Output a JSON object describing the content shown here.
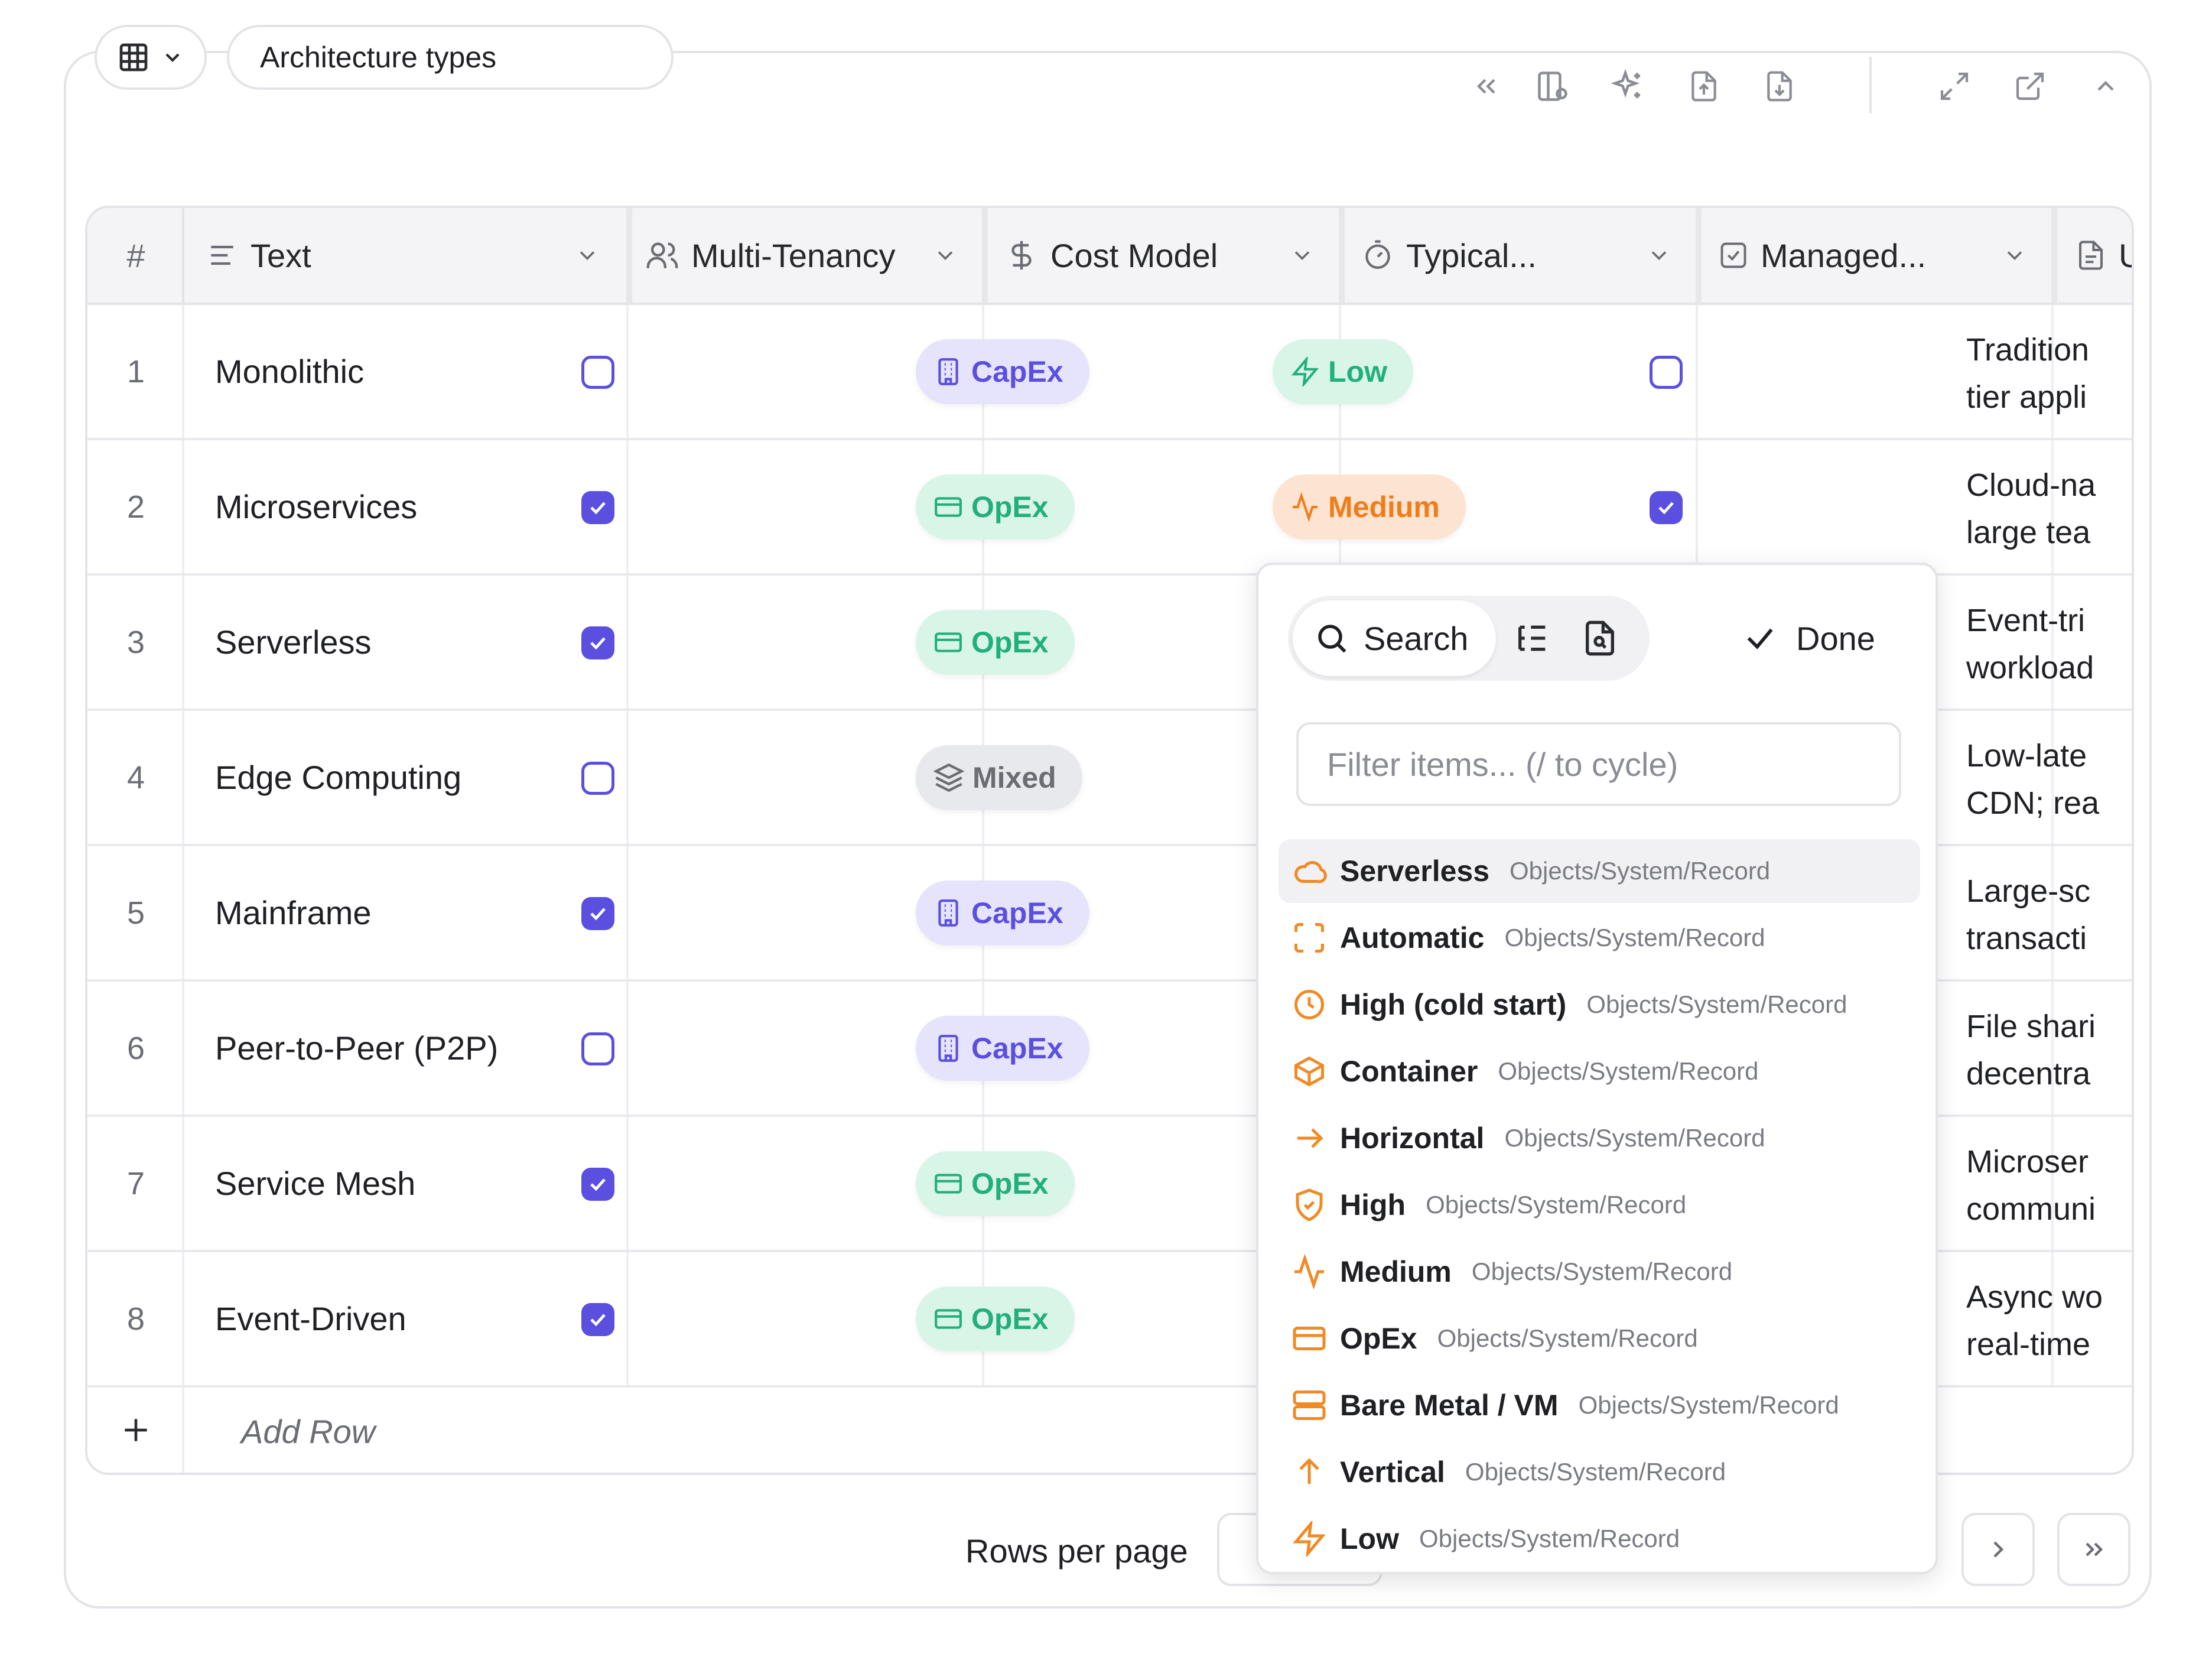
{
  "toolbar": {
    "table_title": "Architecture types"
  },
  "table": {
    "columns": [
      {
        "label": "#"
      },
      {
        "label": "Text",
        "icon": "text-lines-icon"
      },
      {
        "label": "Multi-Tenancy",
        "icon": "users-icon"
      },
      {
        "label": "Cost Model",
        "icon": "dollar-icon"
      },
      {
        "label": "Typical...",
        "icon": "timer-icon"
      },
      {
        "label": "Managed...",
        "icon": "checkbox-icon"
      },
      {
        "label": "Use Ca",
        "icon": "document-icon"
      }
    ],
    "rows": [
      {
        "num": "1",
        "text": "Monolithic",
        "multi_tenancy": false,
        "cost_model": "CapEx",
        "typical": "Low",
        "managed": false,
        "use_case": [
          "Tradition",
          "tier appli"
        ]
      },
      {
        "num": "2",
        "text": "Microservices",
        "multi_tenancy": true,
        "cost_model": "OpEx",
        "typical": "Medium",
        "managed": true,
        "use_case": [
          "Cloud-na",
          "large tea"
        ]
      },
      {
        "num": "3",
        "text": "Serverless",
        "multi_tenancy": true,
        "cost_model": "OpEx",
        "use_case": [
          "Event-tri",
          "workload"
        ]
      },
      {
        "num": "4",
        "text": "Edge Computing",
        "multi_tenancy": false,
        "cost_model": "Mixed",
        "use_case": [
          "Low-late",
          "CDN; rea"
        ]
      },
      {
        "num": "5",
        "text": "Mainframe",
        "multi_tenancy": true,
        "cost_model": "CapEx",
        "use_case": [
          "Large-sc",
          "transacti"
        ]
      },
      {
        "num": "6",
        "text": "Peer-to-Peer (P2P)",
        "multi_tenancy": false,
        "cost_model": "CapEx",
        "use_case": [
          "File shari",
          "decentra"
        ]
      },
      {
        "num": "7",
        "text": "Service Mesh",
        "multi_tenancy": true,
        "cost_model": "OpEx",
        "use_case": [
          "Microser",
          "communi"
        ]
      },
      {
        "num": "8",
        "text": "Event-Driven",
        "multi_tenancy": true,
        "cost_model": "OpEx",
        "use_case": [
          "Async wo",
          "real-time"
        ]
      }
    ],
    "add_row_label": "Add Row"
  },
  "footer": {
    "rows_per_page_label": "Rows per page"
  },
  "dropdown": {
    "search_label": "Search",
    "done_label": "Done",
    "filter_placeholder": "Filter items... (/ to cycle)",
    "items": [
      {
        "name": "Serverless",
        "path": "Objects/System/Record",
        "icon": "cloud-icon"
      },
      {
        "name": "Automatic",
        "path": "Objects/System/Record",
        "icon": "scan-frame-icon"
      },
      {
        "name": "High (cold start)",
        "path": "Objects/System/Record",
        "icon": "clock-icon"
      },
      {
        "name": "Container",
        "path": "Objects/System/Record",
        "icon": "box-icon"
      },
      {
        "name": "Horizontal",
        "path": "Objects/System/Record",
        "icon": "arrow-right-icon"
      },
      {
        "name": "High",
        "path": "Objects/System/Record",
        "icon": "shield-check-icon"
      },
      {
        "name": "Medium",
        "path": "Objects/System/Record",
        "icon": "activity-icon"
      },
      {
        "name": "OpEx",
        "path": "Objects/System/Record",
        "icon": "credit-card-icon"
      },
      {
        "name": "Bare Metal / VM",
        "path": "Objects/System/Record",
        "icon": "server-icon"
      },
      {
        "name": "Vertical",
        "path": "Objects/System/Record",
        "icon": "arrow-up-icon"
      },
      {
        "name": "Low",
        "path": "Objects/System/Record",
        "icon": "zap-icon"
      }
    ]
  },
  "colors": {
    "accent_purple": "#5b4fe0",
    "opex_green": "#22b07a",
    "medium_orange": "#f07d1a",
    "item_icon_orange": "#f08a24"
  }
}
